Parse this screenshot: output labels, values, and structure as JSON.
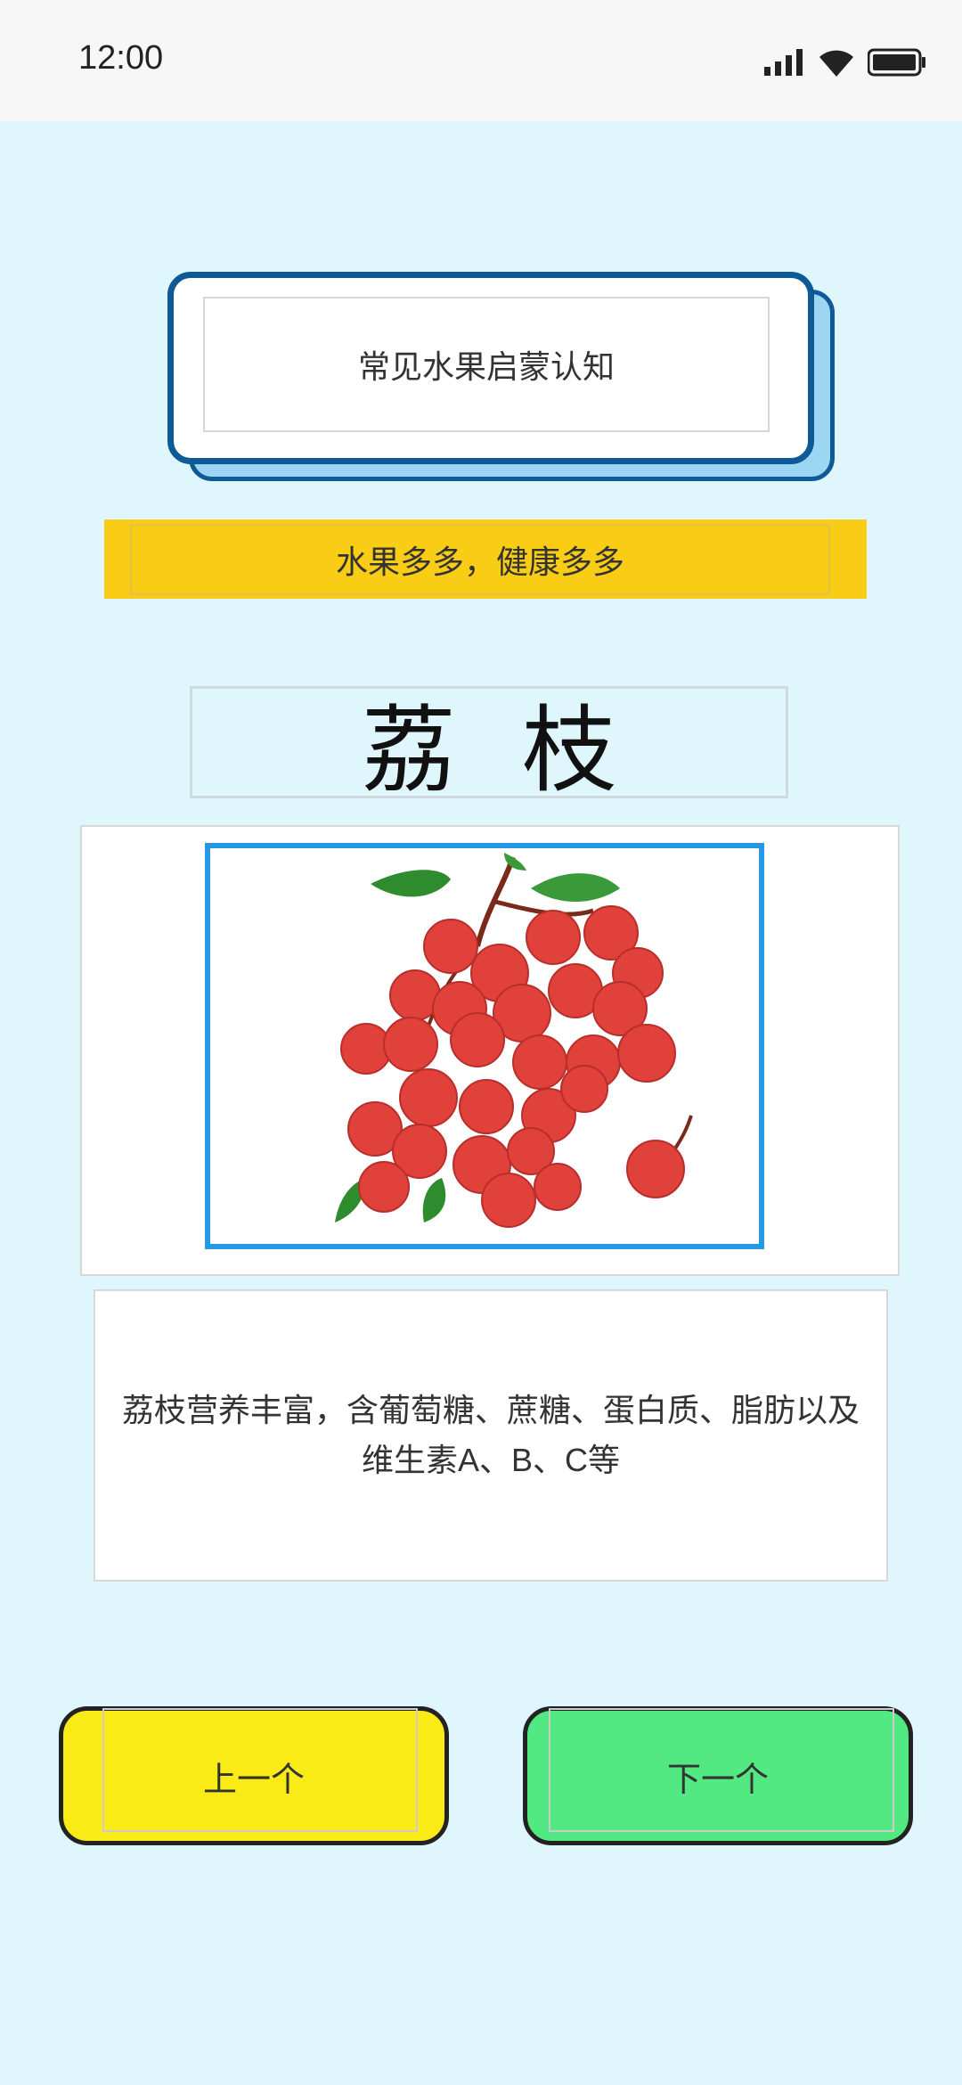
{
  "status_bar": {
    "time": "12:00"
  },
  "header": {
    "title": "常见水果启蒙认知"
  },
  "slogan": "水果多多，健康多多",
  "fruit": {
    "name": "荔枝",
    "description": "荔枝营养丰富，含葡萄糖、蔗糖、蛋白质、脂肪以及维生素A、B、C等"
  },
  "nav": {
    "prev_label": "上一个",
    "next_label": "下一个"
  },
  "colors": {
    "background": "#E0F6FD",
    "title_border": "#0E5A97",
    "slogan_bg": "#F9CC15",
    "image_border": "#2798E5",
    "prev_bg": "#FAEB16",
    "next_bg": "#52E882"
  }
}
